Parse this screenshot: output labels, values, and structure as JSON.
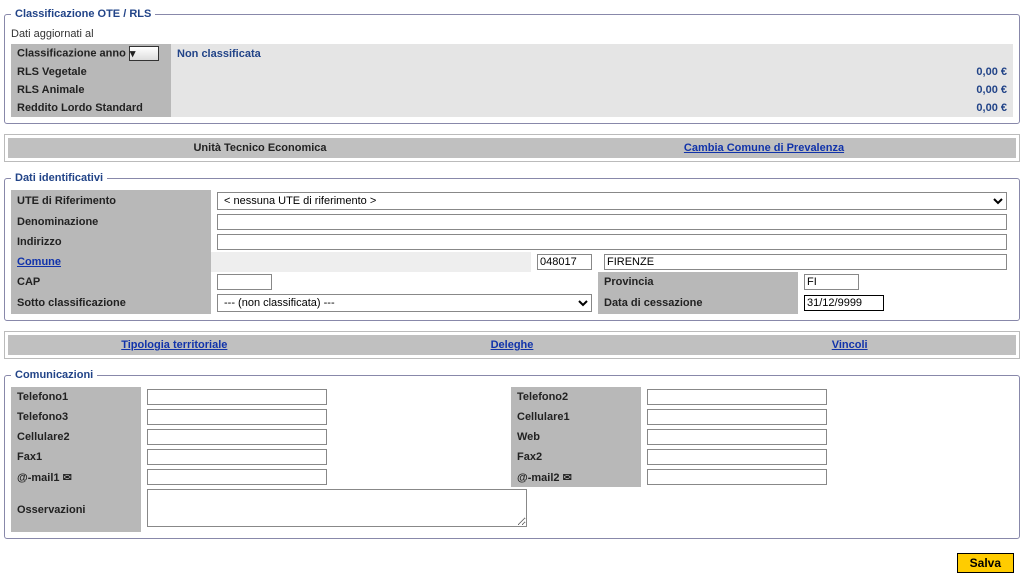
{
  "classificazione": {
    "legend": "Classificazione OTE / RLS",
    "dati_agg": "Dati aggiornati al",
    "rows": {
      "anno_label": "Classificazione anno",
      "anno_value": "Non classificata",
      "rls_veg_label": "RLS Vegetale",
      "rls_veg_value": "0,00 €",
      "rls_ani_label": "RLS Animale",
      "rls_ani_value": "0,00 €",
      "reddito_label": "Reddito Lordo Standard",
      "reddito_value": "0,00 €"
    }
  },
  "ute_header": {
    "col1": "Unità Tecnico Economica",
    "col2": "Cambia Comune di Prevalenza"
  },
  "identificativi": {
    "legend": "Dati identificativi",
    "ute_rif_label": "UTE di Riferimento",
    "ute_rif_value": "< nessuna UTE di riferimento >",
    "denominazione_label": "Denominazione",
    "denominazione_value": "",
    "indirizzo_label": "Indirizzo",
    "indirizzo_value": "",
    "comune_label": "Comune",
    "comune_code": "048017",
    "comune_name": "FIRENZE",
    "cap_label": "CAP",
    "cap_value": "",
    "provincia_label": "Provincia",
    "provincia_value": "FI",
    "sotto_label": "Sotto classificazione",
    "sotto_value": "--- (non classificata) ---",
    "cessazione_label": "Data di cessazione",
    "cessazione_value": "31/12/9999"
  },
  "nav": {
    "tipologia": "Tipologia territoriale",
    "deleghe": "Deleghe",
    "vincoli": "Vincoli"
  },
  "comunicazioni": {
    "legend": "Comunicazioni",
    "telefono1": "Telefono1",
    "telefono2": "Telefono2",
    "telefono3": "Telefono3",
    "cellulare1": "Cellulare1",
    "cellulare2": "Cellulare2",
    "web": "Web",
    "fax1": "Fax1",
    "fax2": "Fax2",
    "email1": "@-mail1",
    "email2": "@-mail2",
    "osservazioni": "Osservazioni",
    "osservazioni_value": ""
  },
  "buttons": {
    "salva": "Salva"
  }
}
